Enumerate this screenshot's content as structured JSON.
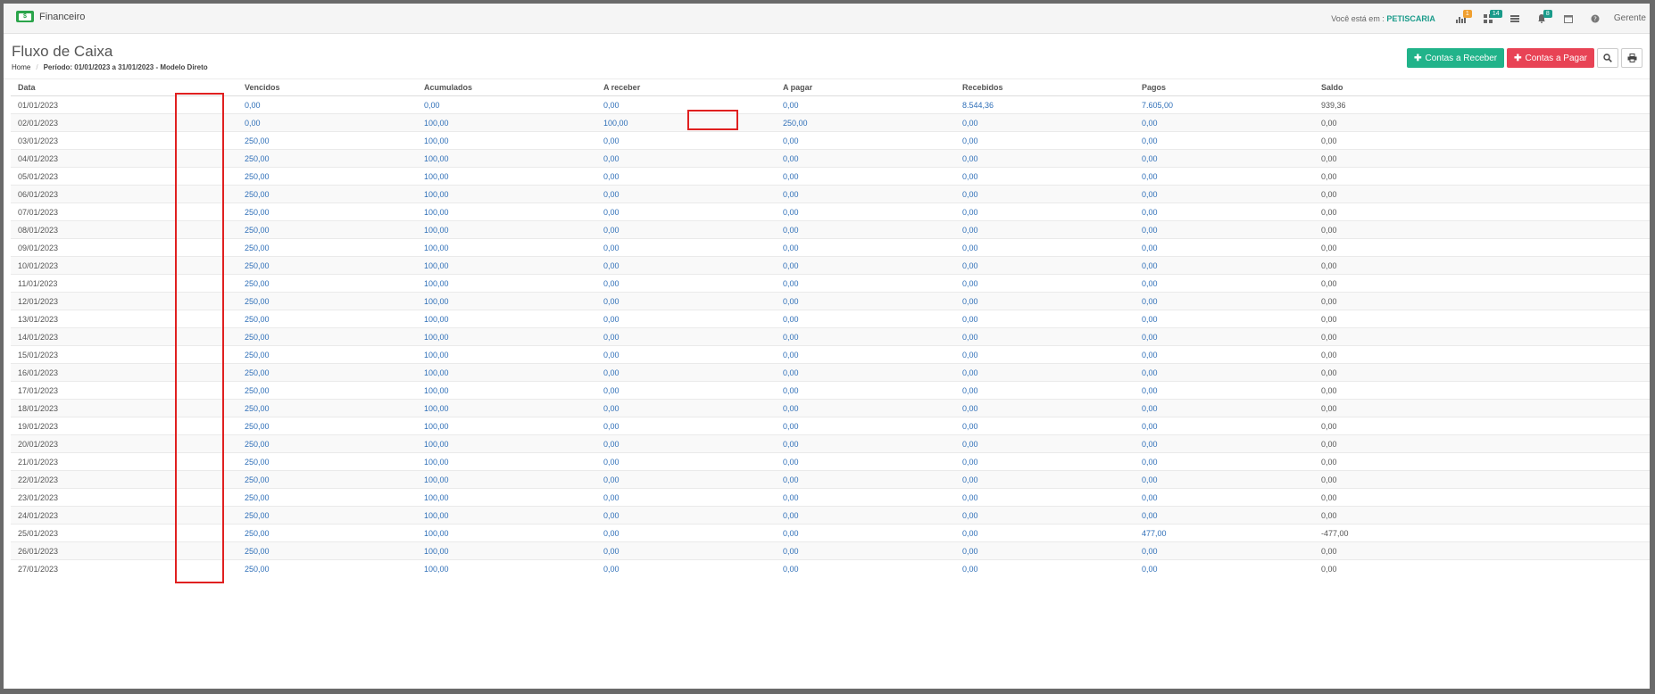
{
  "app": {
    "module": "Financeiro",
    "brand_glyph": "$"
  },
  "topbar": {
    "location_label": "Você está em :",
    "location_value": "PETISCARIA",
    "icons": [
      {
        "name": "stats-icon",
        "badge": "1",
        "badge_color": "#f0a030"
      },
      {
        "name": "grid-icon",
        "badge": "14",
        "badge_color": "#1a9b8a"
      },
      {
        "name": "list-icon",
        "badge": ""
      },
      {
        "name": "bell-icon",
        "badge": "8",
        "badge_color": "#1a9b8a"
      },
      {
        "name": "calendar-icon",
        "badge": ""
      },
      {
        "name": "help-icon",
        "badge": ""
      }
    ],
    "user": "Gerente"
  },
  "page": {
    "title": "Fluxo de Caixa",
    "breadcrumb": {
      "home": "Home",
      "current": "Período: 01/01/2023 a 31/01/2023 - Modelo Direto"
    },
    "actions": {
      "receivable": "Contas a Receber",
      "payable": "Contas a Pagar",
      "search_icon": "search-icon",
      "print_icon": "print-icon"
    }
  },
  "colors": {
    "green": "#21b38a",
    "red": "#e84355",
    "link": "#2f6fb8",
    "highlight": "#e02020"
  },
  "table": {
    "columns": [
      "Data",
      "Vencidos",
      "Acumulados",
      "A receber",
      "A pagar",
      "Recebidos",
      "Pagos",
      "Saldo"
    ],
    "rows": [
      [
        "01/01/2023",
        "0,00",
        "0,00",
        "0,00",
        "0,00",
        "8.544,36",
        "7.605,00",
        "939,36"
      ],
      [
        "02/01/2023",
        "0,00",
        "100,00",
        "100,00",
        "250,00",
        "0,00",
        "0,00",
        "0,00"
      ],
      [
        "03/01/2023",
        "250,00",
        "100,00",
        "0,00",
        "0,00",
        "0,00",
        "0,00",
        "0,00"
      ],
      [
        "04/01/2023",
        "250,00",
        "100,00",
        "0,00",
        "0,00",
        "0,00",
        "0,00",
        "0,00"
      ],
      [
        "05/01/2023",
        "250,00",
        "100,00",
        "0,00",
        "0,00",
        "0,00",
        "0,00",
        "0,00"
      ],
      [
        "06/01/2023",
        "250,00",
        "100,00",
        "0,00",
        "0,00",
        "0,00",
        "0,00",
        "0,00"
      ],
      [
        "07/01/2023",
        "250,00",
        "100,00",
        "0,00",
        "0,00",
        "0,00",
        "0,00",
        "0,00"
      ],
      [
        "08/01/2023",
        "250,00",
        "100,00",
        "0,00",
        "0,00",
        "0,00",
        "0,00",
        "0,00"
      ],
      [
        "09/01/2023",
        "250,00",
        "100,00",
        "0,00",
        "0,00",
        "0,00",
        "0,00",
        "0,00"
      ],
      [
        "10/01/2023",
        "250,00",
        "100,00",
        "0,00",
        "0,00",
        "0,00",
        "0,00",
        "0,00"
      ],
      [
        "11/01/2023",
        "250,00",
        "100,00",
        "0,00",
        "0,00",
        "0,00",
        "0,00",
        "0,00"
      ],
      [
        "12/01/2023",
        "250,00",
        "100,00",
        "0,00",
        "0,00",
        "0,00",
        "0,00",
        "0,00"
      ],
      [
        "13/01/2023",
        "250,00",
        "100,00",
        "0,00",
        "0,00",
        "0,00",
        "0,00",
        "0,00"
      ],
      [
        "14/01/2023",
        "250,00",
        "100,00",
        "0,00",
        "0,00",
        "0,00",
        "0,00",
        "0,00"
      ],
      [
        "15/01/2023",
        "250,00",
        "100,00",
        "0,00",
        "0,00",
        "0,00",
        "0,00",
        "0,00"
      ],
      [
        "16/01/2023",
        "250,00",
        "100,00",
        "0,00",
        "0,00",
        "0,00",
        "0,00",
        "0,00"
      ],
      [
        "17/01/2023",
        "250,00",
        "100,00",
        "0,00",
        "0,00",
        "0,00",
        "0,00",
        "0,00"
      ],
      [
        "18/01/2023",
        "250,00",
        "100,00",
        "0,00",
        "0,00",
        "0,00",
        "0,00",
        "0,00"
      ],
      [
        "19/01/2023",
        "250,00",
        "100,00",
        "0,00",
        "0,00",
        "0,00",
        "0,00",
        "0,00"
      ],
      [
        "20/01/2023",
        "250,00",
        "100,00",
        "0,00",
        "0,00",
        "0,00",
        "0,00",
        "0,00"
      ],
      [
        "21/01/2023",
        "250,00",
        "100,00",
        "0,00",
        "0,00",
        "0,00",
        "0,00",
        "0,00"
      ],
      [
        "22/01/2023",
        "250,00",
        "100,00",
        "0,00",
        "0,00",
        "0,00",
        "0,00",
        "0,00"
      ],
      [
        "23/01/2023",
        "250,00",
        "100,00",
        "0,00",
        "0,00",
        "0,00",
        "0,00",
        "0,00"
      ],
      [
        "24/01/2023",
        "250,00",
        "100,00",
        "0,00",
        "0,00",
        "0,00",
        "0,00",
        "0,00"
      ],
      [
        "25/01/2023",
        "250,00",
        "100,00",
        "0,00",
        "0,00",
        "0,00",
        "477,00",
        "-477,00"
      ],
      [
        "26/01/2023",
        "250,00",
        "100,00",
        "0,00",
        "0,00",
        "0,00",
        "0,00",
        "0,00"
      ],
      [
        "27/01/2023",
        "250,00",
        "100,00",
        "0,00",
        "0,00",
        "0,00",
        "0,00",
        "0,00"
      ]
    ]
  }
}
